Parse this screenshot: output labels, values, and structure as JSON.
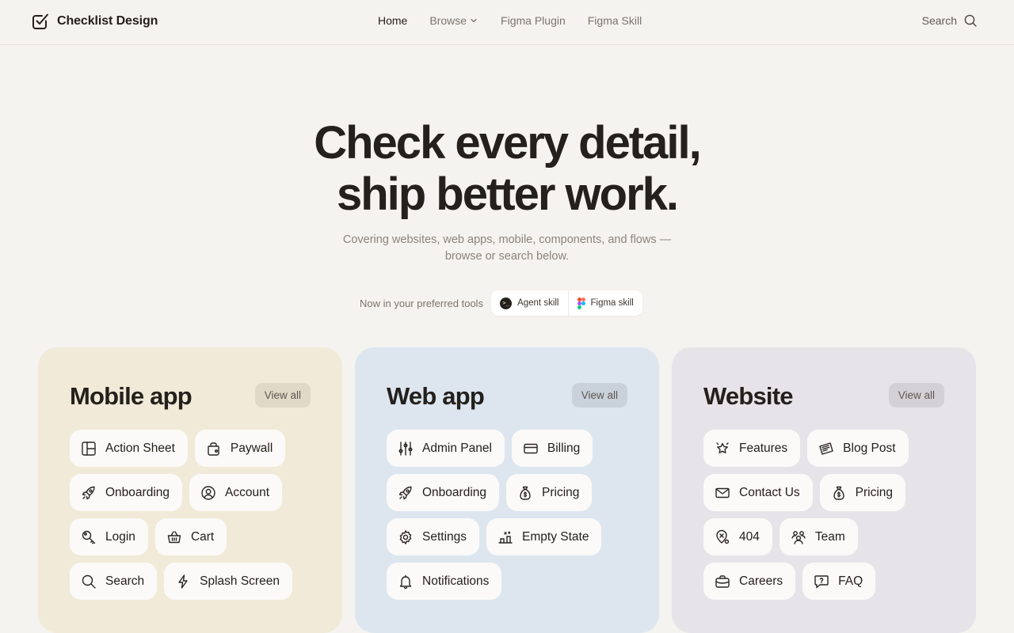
{
  "header": {
    "brand": "Checklist Design",
    "nav": {
      "home": "Home",
      "browse": "Browse",
      "figma_plugin": "Figma Plugin",
      "figma_skill": "Figma Skill"
    },
    "search_label": "Search"
  },
  "hero": {
    "title_line1": "Check every detail,",
    "title_line2": "ship better work.",
    "subtitle_line1": "Covering websites, web apps, mobile, components, and flows —",
    "subtitle_line2": "browse or search below."
  },
  "tools": {
    "label": "Now in your preferred tools",
    "agent_skill": "Agent skill",
    "figma_skill": "Figma skill"
  },
  "colors": {
    "background": "#f5f3ef",
    "mobile_card": "#f1ead8",
    "web_card": "#dde6ef",
    "website_card": "#e6e4e8"
  },
  "cards": {
    "mobile": {
      "title": "Mobile app",
      "view_all": "View all",
      "items": [
        {
          "label": "Action Sheet",
          "icon": "action-sheet-icon"
        },
        {
          "label": "Paywall",
          "icon": "paywall-icon"
        },
        {
          "label": "Onboarding",
          "icon": "rocket-icon"
        },
        {
          "label": "Account",
          "icon": "account-icon"
        },
        {
          "label": "Login",
          "icon": "key-icon"
        },
        {
          "label": "Cart",
          "icon": "basket-icon"
        },
        {
          "label": "Search",
          "icon": "search-icon"
        },
        {
          "label": "Splash Screen",
          "icon": "bolt-icon"
        }
      ]
    },
    "web": {
      "title": "Web app",
      "view_all": "View all",
      "items": [
        {
          "label": "Admin Panel",
          "icon": "sliders-icon"
        },
        {
          "label": "Billing",
          "icon": "card-icon"
        },
        {
          "label": "Onboarding",
          "icon": "rocket-icon"
        },
        {
          "label": "Pricing",
          "icon": "money-bag-icon"
        },
        {
          "label": "Settings",
          "icon": "gear-icon"
        },
        {
          "label": "Empty State",
          "icon": "empty-state-icon"
        },
        {
          "label": "Notifications",
          "icon": "bell-icon"
        }
      ]
    },
    "website": {
      "title": "Website",
      "view_all": "View all",
      "items": [
        {
          "label": "Features",
          "icon": "star-icon"
        },
        {
          "label": "Blog Post",
          "icon": "blog-icon"
        },
        {
          "label": "Contact Us",
          "icon": "mail-icon"
        },
        {
          "label": "Pricing",
          "icon": "money-bag-icon"
        },
        {
          "label": "404",
          "icon": "map-pin-icon"
        },
        {
          "label": "Team",
          "icon": "team-icon"
        },
        {
          "label": "Careers",
          "icon": "briefcase-icon"
        },
        {
          "label": "FAQ",
          "icon": "faq-icon"
        }
      ]
    }
  }
}
